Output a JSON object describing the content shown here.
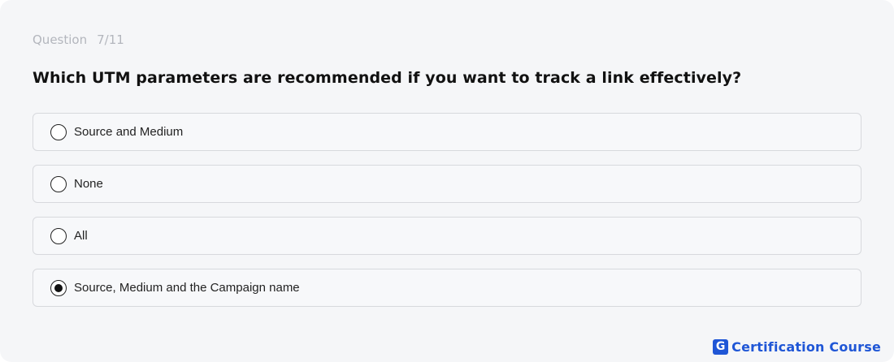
{
  "header": {
    "question_label": "Question",
    "progress": "7/11"
  },
  "question": {
    "text": "Which UTM parameters are recommended if you want to track a link effectively?"
  },
  "options": [
    {
      "label": "Source and Medium",
      "selected": false
    },
    {
      "label": "None",
      "selected": false
    },
    {
      "label": "All",
      "selected": false
    },
    {
      "label": "Source, Medium and the Campaign name",
      "selected": true
    }
  ],
  "brand": {
    "logo_letter": "G",
    "name": "Certification Course",
    "color": "#1f56d6"
  }
}
